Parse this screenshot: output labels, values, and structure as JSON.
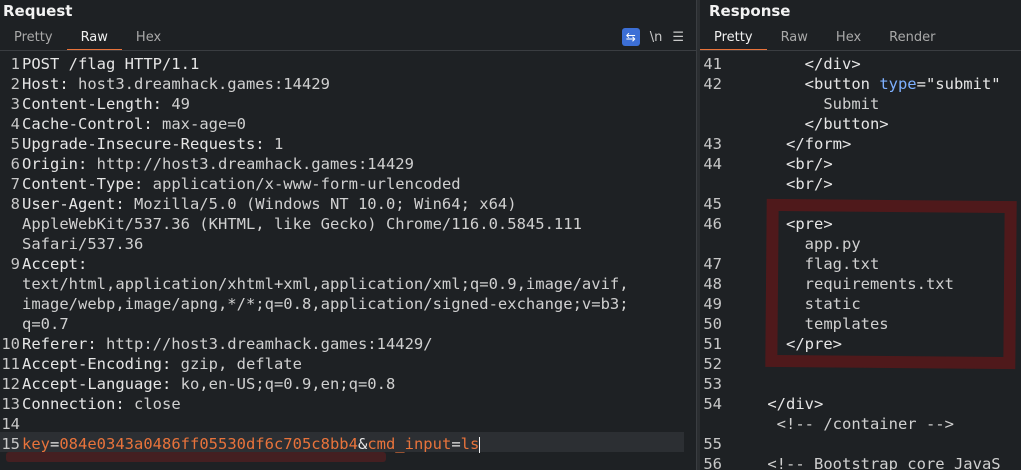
{
  "request": {
    "title": "Request",
    "tabs": [
      "Pretty",
      "Raw",
      "Hex"
    ],
    "active_tab": "Raw",
    "tools": {
      "wrap_icon": "wrap-lines-icon",
      "newline_label": "\\n",
      "menu_icon": "hamburger-menu-icon"
    },
    "lines": [
      {
        "n": "1",
        "parts": [
          [
            "POST /flag HTTP/1.1",
            "hk"
          ]
        ]
      },
      {
        "n": "2",
        "parts": [
          [
            "Host:",
            "hk"
          ],
          [
            " host3.dreamhack.games:14429",
            "hv"
          ]
        ]
      },
      {
        "n": "3",
        "parts": [
          [
            "Content-Length:",
            "hk"
          ],
          [
            " 49",
            "hv"
          ]
        ]
      },
      {
        "n": "4",
        "parts": [
          [
            "Cache-Control:",
            "hk"
          ],
          [
            " max-age=0",
            "hv"
          ]
        ]
      },
      {
        "n": "5",
        "parts": [
          [
            "Upgrade-Insecure-Requests:",
            "hk"
          ],
          [
            " 1",
            "hv"
          ]
        ]
      },
      {
        "n": "6",
        "parts": [
          [
            "Origin:",
            "hk"
          ],
          [
            " http://host3.dreamhack.games:14429",
            "hv"
          ]
        ]
      },
      {
        "n": "7",
        "parts": [
          [
            "Content-Type:",
            "hk"
          ],
          [
            " application/x-www-form-urlencoded",
            "hv"
          ]
        ]
      },
      {
        "n": "8",
        "parts": [
          [
            "User-Agent:",
            "hk"
          ],
          [
            " Mozilla/5.0 (Windows NT 10.0; Win64; x64)",
            "hv"
          ]
        ]
      },
      {
        "n": "",
        "parts": [
          [
            "AppleWebKit/537.36 (KHTML, like Gecko) Chrome/116.0.5845.111",
            "hv"
          ]
        ]
      },
      {
        "n": "",
        "parts": [
          [
            "Safari/537.36",
            "hv"
          ]
        ]
      },
      {
        "n": "9",
        "parts": [
          [
            "Accept:",
            "hk"
          ]
        ]
      },
      {
        "n": "",
        "parts": [
          [
            "text/html,application/xhtml+xml,application/xml;q=0.9,image/avif,",
            "hv"
          ]
        ]
      },
      {
        "n": "",
        "parts": [
          [
            "image/webp,image/apng,*/*;q=0.8,application/signed-exchange;v=b3;",
            "hv"
          ]
        ]
      },
      {
        "n": "",
        "parts": [
          [
            "q=0.7",
            "hv"
          ]
        ]
      },
      {
        "n": "10",
        "parts": [
          [
            "Referer:",
            "hk"
          ],
          [
            " http://host3.dreamhack.games:14429/",
            "hv"
          ]
        ]
      },
      {
        "n": "11",
        "parts": [
          [
            "Accept-Encoding:",
            "hk"
          ],
          [
            " gzip, deflate",
            "hv"
          ]
        ]
      },
      {
        "n": "12",
        "parts": [
          [
            "Accept-Language:",
            "hk"
          ],
          [
            " ko,en-US;q=0.9,en;q=0.8",
            "hv"
          ]
        ]
      },
      {
        "n": "13",
        "parts": [
          [
            "Connection:",
            "hk"
          ],
          [
            " close",
            "hv"
          ]
        ]
      },
      {
        "n": "14",
        "parts": []
      },
      {
        "n": "15",
        "parts": [
          [
            "key",
            "body-key"
          ],
          [
            "=",
            "hk"
          ],
          [
            "084e0343a0486ff05530df6c705c8bb4",
            "body-val"
          ],
          [
            "&",
            "hk"
          ],
          [
            "cmd_input",
            "body-key"
          ],
          [
            "=",
            "hk"
          ],
          [
            "ls",
            "body-val"
          ]
        ]
      }
    ]
  },
  "response": {
    "title": "Response",
    "tabs": [
      "Pretty",
      "Raw",
      "Hex",
      "Render"
    ],
    "active_tab": "Pretty",
    "lines": [
      {
        "n": "41",
        "parts": [
          [
            "        </div>",
            "tag"
          ]
        ]
      },
      {
        "n": "42",
        "parts": [
          [
            "        <button ",
            "tag"
          ],
          [
            "type",
            "attr"
          ],
          [
            "=\"submit\"",
            "str"
          ]
        ]
      },
      {
        "n": "",
        "parts": [
          [
            "          Submit",
            "hv"
          ]
        ]
      },
      {
        "n": "",
        "parts": [
          [
            "        </button>",
            "tag"
          ]
        ]
      },
      {
        "n": "43",
        "parts": [
          [
            "      </form>",
            "tag"
          ]
        ]
      },
      {
        "n": "44",
        "parts": [
          [
            "      <br/>",
            "tag"
          ]
        ]
      },
      {
        "n": "",
        "parts": [
          [
            "      <br/>",
            "tag"
          ]
        ]
      },
      {
        "n": "45",
        "parts": []
      },
      {
        "n": "46",
        "parts": [
          [
            "      <pre>",
            "tag"
          ]
        ]
      },
      {
        "n": "",
        "parts": [
          [
            "        app.py",
            "hv"
          ]
        ]
      },
      {
        "n": "47",
        "parts": [
          [
            "        flag.txt",
            "hv"
          ]
        ]
      },
      {
        "n": "48",
        "parts": [
          [
            "        requirements.txt",
            "hv"
          ]
        ]
      },
      {
        "n": "49",
        "parts": [
          [
            "        static",
            "hv"
          ]
        ]
      },
      {
        "n": "50",
        "parts": [
          [
            "        templates",
            "hv"
          ]
        ]
      },
      {
        "n": "51",
        "parts": [
          [
            "      </pre>",
            "tag"
          ]
        ]
      },
      {
        "n": "52",
        "parts": []
      },
      {
        "n": "53",
        "parts": []
      },
      {
        "n": "54",
        "parts": [
          [
            "    </div>",
            "tag"
          ]
        ]
      },
      {
        "n": "",
        "parts": [
          [
            "     <!-- /container -->",
            "cmt"
          ]
        ]
      },
      {
        "n": "55",
        "parts": []
      },
      {
        "n": "56",
        "parts": [
          [
            "    <!-- Bootstrap core JavaS",
            "cmt"
          ]
        ]
      }
    ]
  }
}
